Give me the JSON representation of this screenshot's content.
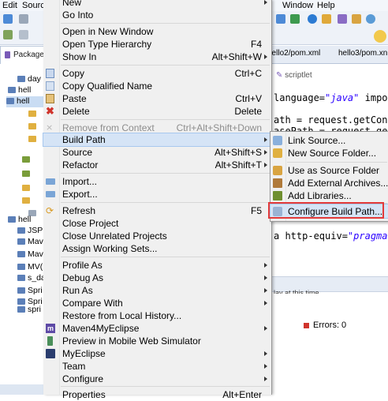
{
  "menubar": {
    "edit": "Edit",
    "source": "Sourc",
    "window": "Window",
    "help": "Help"
  },
  "package_tab": {
    "label": "Package"
  },
  "tree": {
    "items": [
      "day",
      "hell",
      "hell",
      "",
      "",
      "",
      "",
      "",
      "",
      "",
      "",
      "hell",
      "JSP",
      "Mav",
      "Mav",
      "MV(",
      "s_da",
      "Spri",
      "Spri",
      "spri"
    ]
  },
  "editor": {
    "tabs": [
      "hello2/pom.xml",
      "hello3/pom.xn"
    ],
    "scriptlet_label": "scriptlet",
    "code": {
      "line1_pre": " language=",
      "line1_kw": "\"java\"",
      "line1_post": " impo",
      "line2": "ath = request.getCont",
      "line3": "asePath = request.get",
      "line4_pre": "a http-equiv=",
      "line4_kw": "\"pragma\""
    },
    "bottom_text": "lay at this time"
  },
  "errors": {
    "label": "Errors: 0"
  },
  "context_menu": {
    "items": [
      {
        "label": "New",
        "shortcut": "",
        "arrow": true
      },
      {
        "label": "Go Into",
        "shortcut": ""
      },
      {
        "label": "Open in New Window",
        "shortcut": ""
      },
      {
        "label": "Open Type Hierarchy",
        "shortcut": "F4"
      },
      {
        "label": "Show In",
        "shortcut": "Alt+Shift+W",
        "arrow": true
      },
      {
        "label": "Copy",
        "shortcut": "Ctrl+C",
        "icon": "copy-icon"
      },
      {
        "label": "Copy Qualified Name",
        "shortcut": "",
        "icon": "copy-qualified-icon"
      },
      {
        "label": "Paste",
        "shortcut": "Ctrl+V",
        "icon": "paste-icon"
      },
      {
        "label": "Delete",
        "shortcut": "Delete",
        "icon": "delete-icon"
      },
      {
        "label": "Remove from Context",
        "shortcut": "Ctrl+Alt+Shift+Down",
        "disabled": true,
        "icon": "remove-context-icon"
      },
      {
        "label": "Build Path",
        "shortcut": "",
        "arrow": true,
        "highlighted": true
      },
      {
        "label": "Source",
        "shortcut": "Alt+Shift+S",
        "arrow": true
      },
      {
        "label": "Refactor",
        "shortcut": "Alt+Shift+T",
        "arrow": true
      },
      {
        "label": "Import...",
        "shortcut": "",
        "icon": "import-icon"
      },
      {
        "label": "Export...",
        "shortcut": "",
        "icon": "export-icon"
      },
      {
        "label": "Refresh",
        "shortcut": "F5",
        "icon": "refresh-icon"
      },
      {
        "label": "Close Project",
        "shortcut": ""
      },
      {
        "label": "Close Unrelated Projects",
        "shortcut": ""
      },
      {
        "label": "Assign Working Sets...",
        "shortcut": ""
      },
      {
        "label": "Profile As",
        "shortcut": "",
        "arrow": true
      },
      {
        "label": "Debug As",
        "shortcut": "",
        "arrow": true
      },
      {
        "label": "Run As",
        "shortcut": "",
        "arrow": true
      },
      {
        "label": "Compare With",
        "shortcut": "",
        "arrow": true
      },
      {
        "label": "Restore from Local History...",
        "shortcut": ""
      },
      {
        "label": "Maven4MyEclipse",
        "shortcut": "",
        "arrow": true,
        "icon": "maven-icon"
      },
      {
        "label": "Preview in Mobile Web Simulator",
        "shortcut": "",
        "icon": "mobile-icon"
      },
      {
        "label": "MyEclipse",
        "shortcut": "",
        "arrow": true,
        "icon": "myeclipse-icon"
      },
      {
        "label": "Team",
        "shortcut": "",
        "arrow": true
      },
      {
        "label": "Configure",
        "shortcut": "",
        "arrow": true
      },
      {
        "label": "Properties",
        "shortcut": "Alt+Enter"
      }
    ]
  },
  "build_path_submenu": {
    "items": [
      {
        "label": "Link Source...",
        "icon": "link-source-icon"
      },
      {
        "label": "New Source Folder...",
        "icon": "new-source-folder-icon"
      },
      {
        "label": "Use as Source Folder",
        "icon": "use-source-folder-icon"
      },
      {
        "label": "Add External Archives...",
        "icon": "external-archive-icon"
      },
      {
        "label": "Add Libraries...",
        "icon": "library-icon"
      },
      {
        "label": "Configure Build Path...",
        "icon": "configure-build-path-icon",
        "highlighted": true
      }
    ]
  },
  "colors": {
    "highlight": "#d5e4f6",
    "highlight_border": "#a8c8ee",
    "callout": "#e23a3a",
    "menu_bg": "#f0f0f0"
  }
}
